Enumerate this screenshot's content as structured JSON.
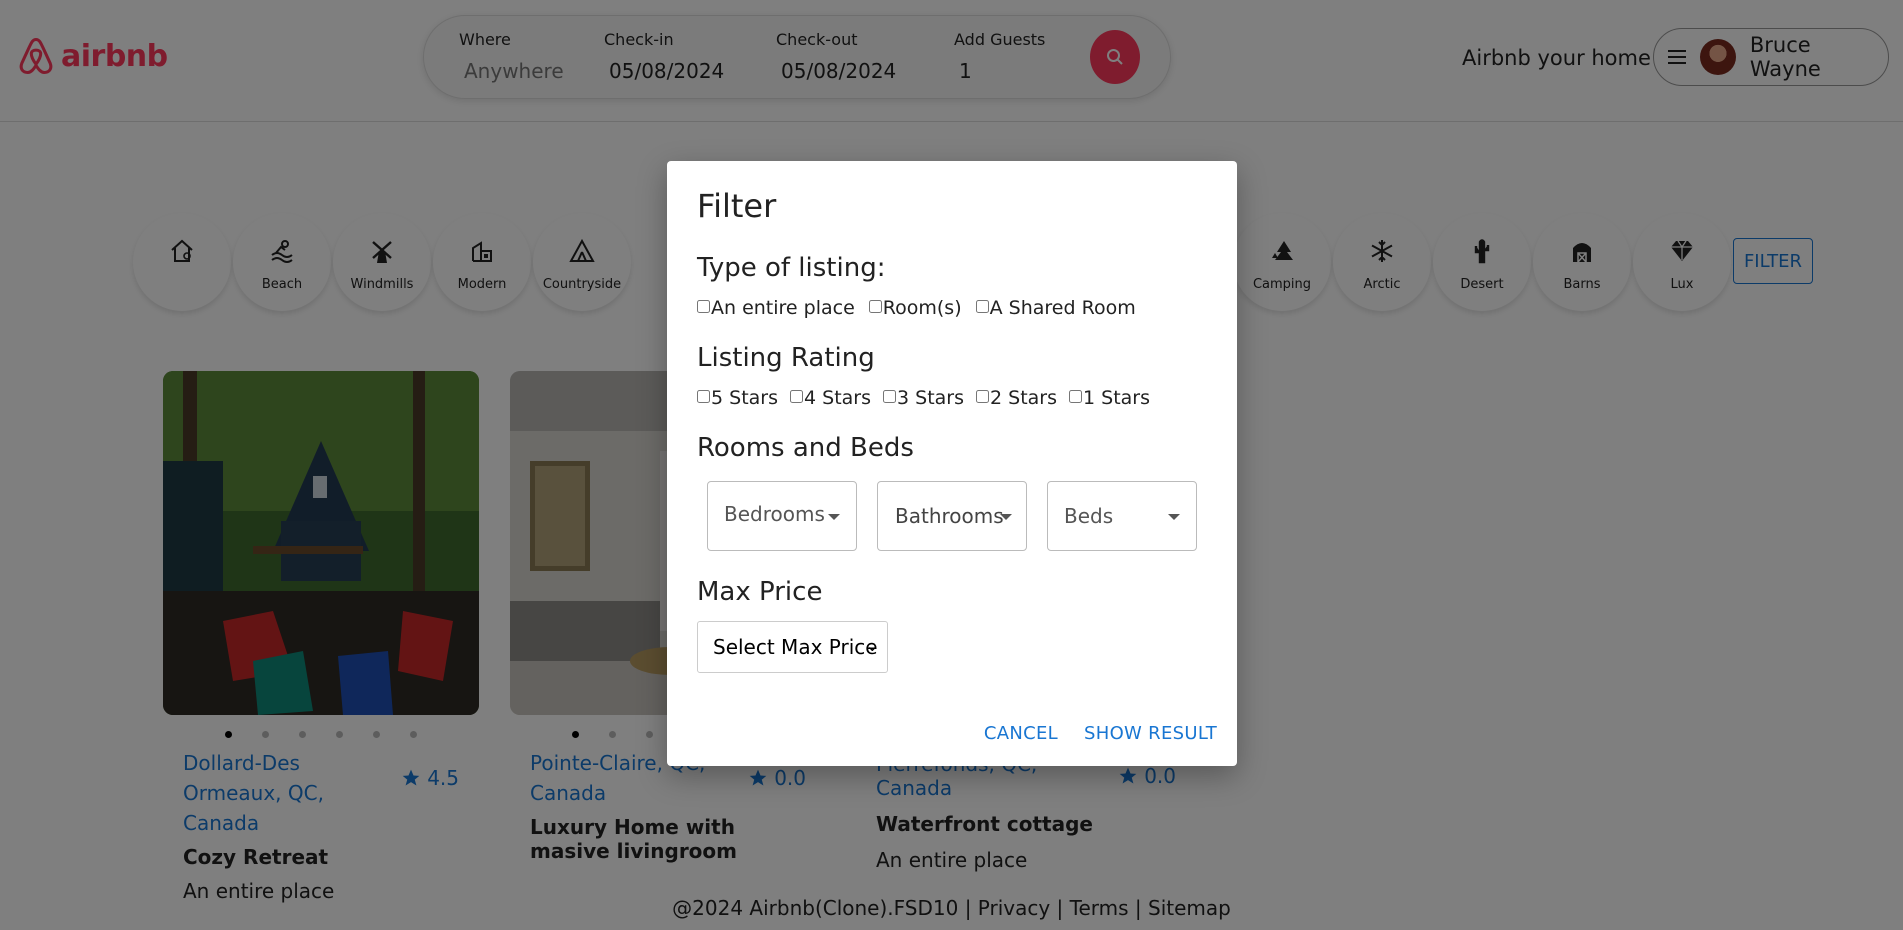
{
  "brand": {
    "name": "airbnb",
    "color": "#ff385c"
  },
  "search": {
    "where_label": "Where",
    "where_placeholder": "Anywhere",
    "checkin_label": "Check-in",
    "checkin_value": "05/08/2024",
    "checkout_label": "Check-out",
    "checkout_value": "05/08/2024",
    "guests_label": "Add Guests",
    "guests_value": "1",
    "button_icon": "search-icon"
  },
  "header": {
    "host_link": "Airbnb your home",
    "user_name": "Bruce Wayne",
    "menu_icon": "hamburger-icon"
  },
  "categories": [
    {
      "label": "",
      "icon": "house-icon"
    },
    {
      "label": "Beach",
      "icon": "beach-icon"
    },
    {
      "label": "Windmills",
      "icon": "windmill-icon"
    },
    {
      "label": "Modern",
      "icon": "modern-icon"
    },
    {
      "label": "Countryside",
      "icon": "tent-icon"
    },
    {
      "label": "Camping",
      "icon": "tree-icon"
    },
    {
      "label": "Arctic",
      "icon": "snowflake-icon"
    },
    {
      "label": "Desert",
      "icon": "cactus-icon"
    },
    {
      "label": "Barns",
      "icon": "barn-icon"
    },
    {
      "label": "Lux",
      "icon": "diamond-icon"
    }
  ],
  "filter_button": "FILTER",
  "listings": [
    {
      "location": "Dollard-Des Ormeaux, QC, Canada",
      "rating": "4.5",
      "title": "Cozy Retreat",
      "type": "An entire place"
    },
    {
      "location": "Pointe-Claire, QC, Canada",
      "rating": "0.0",
      "title": "Luxury Home with masive livingroom",
      "type": ""
    },
    {
      "location": "Pierrefonds, QC, Canada",
      "rating": "0.0",
      "title": "Waterfront cottage",
      "type": "An entire place"
    }
  ],
  "footer": "@2024 Airbnb(Clone).FSD10 | Privacy | Terms | Sitemap",
  "modal": {
    "title": "Filter",
    "type_heading": "Type of listing:",
    "type_options": [
      "An entire place",
      "Room(s)",
      "A Shared Room"
    ],
    "rating_heading": "Listing Rating",
    "rating_options": [
      "5 Stars",
      "4 Stars",
      "3 Stars",
      "2 Stars",
      "1 Stars"
    ],
    "rooms_heading": "Rooms and Beds",
    "bedrooms": "Bedrooms",
    "bathrooms": "Bathrooms",
    "beds": "Beds",
    "price_heading": "Max Price",
    "price_select": "Select Max Price",
    "cancel": "CANCEL",
    "show_result": "SHOW RESULT"
  },
  "colors": {
    "accent": "#1976d2",
    "overlay": "rgba(0,0,0,0.5)"
  }
}
